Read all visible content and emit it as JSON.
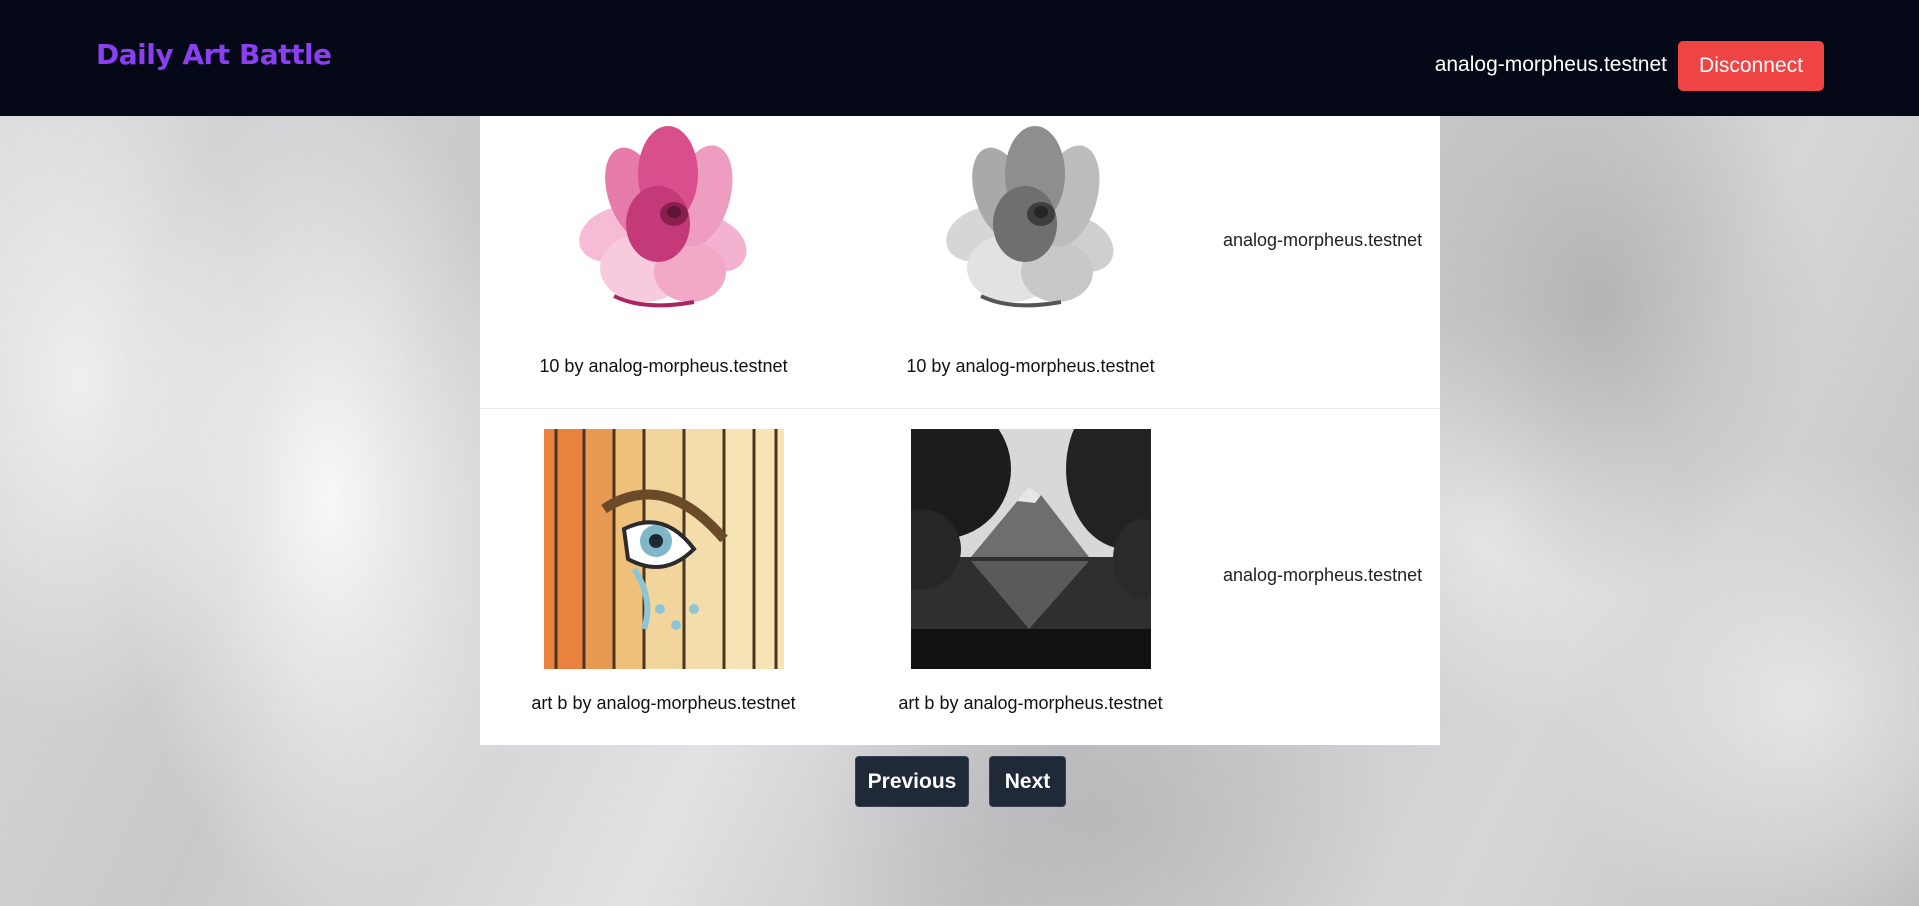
{
  "header": {
    "brand": "Daily Art Battle",
    "account": "analog-morpheus.testnet",
    "disconnect_label": "Disconnect"
  },
  "battles": [
    {
      "art_a": {
        "image": "pink-magnolia-flower",
        "caption": "10 by analog-morpheus.testnet"
      },
      "art_b": {
        "image": "grayscale-magnolia-flower",
        "caption": "10 by analog-morpheus.testnet"
      },
      "owner": "analog-morpheus.testnet"
    },
    {
      "art_a": {
        "image": "painted-eye-on-wooden-fence",
        "caption": "art b by analog-morpheus.testnet"
      },
      "art_b": {
        "image": "grayscale-mountain-lake",
        "caption": "art b by analog-morpheus.testnet"
      },
      "owner": "analog-morpheus.testnet"
    }
  ],
  "pagination": {
    "previous_label": "Previous",
    "next_label": "Next"
  },
  "colors": {
    "navbar_bg": "#050816",
    "brand": "#8a3ff0",
    "disconnect_bg": "#ef4444",
    "pager_bg": "#1f2937"
  }
}
